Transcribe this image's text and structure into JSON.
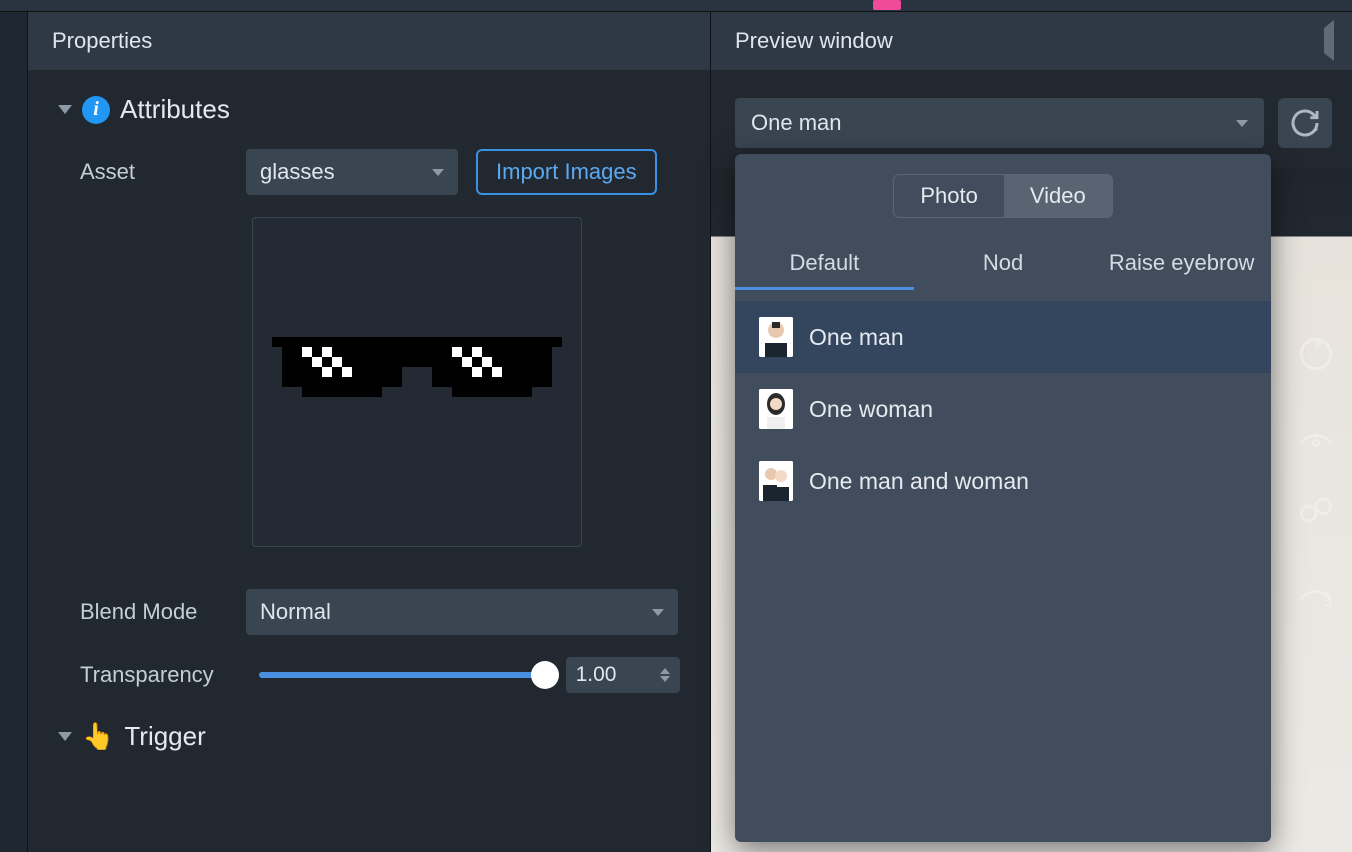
{
  "panels": {
    "properties_title": "Properties",
    "preview_title": "Preview window"
  },
  "attributes": {
    "section_title": "Attributes",
    "asset_label": "Asset",
    "asset_selected": "glasses",
    "import_button": "Import Images",
    "blend_mode_label": "Blend Mode",
    "blend_mode_selected": "Normal",
    "transparency_label": "Transparency",
    "transparency_value": "1.00"
  },
  "trigger": {
    "section_title": "Trigger"
  },
  "preview": {
    "selected": "One man",
    "segments": {
      "photo": "Photo",
      "video": "Video",
      "active": "video"
    },
    "tabs": {
      "default": "Default",
      "nod": "Nod",
      "raise_eyebrow": "Raise eyebrow",
      "active": "default"
    },
    "options": [
      {
        "label": "One man",
        "selected": true
      },
      {
        "label": "One woman",
        "selected": false
      },
      {
        "label": "One man and woman",
        "selected": false
      }
    ]
  },
  "colors": {
    "accent": "#4a90e2",
    "panel": "#22282f",
    "popup": "#414d5c"
  }
}
